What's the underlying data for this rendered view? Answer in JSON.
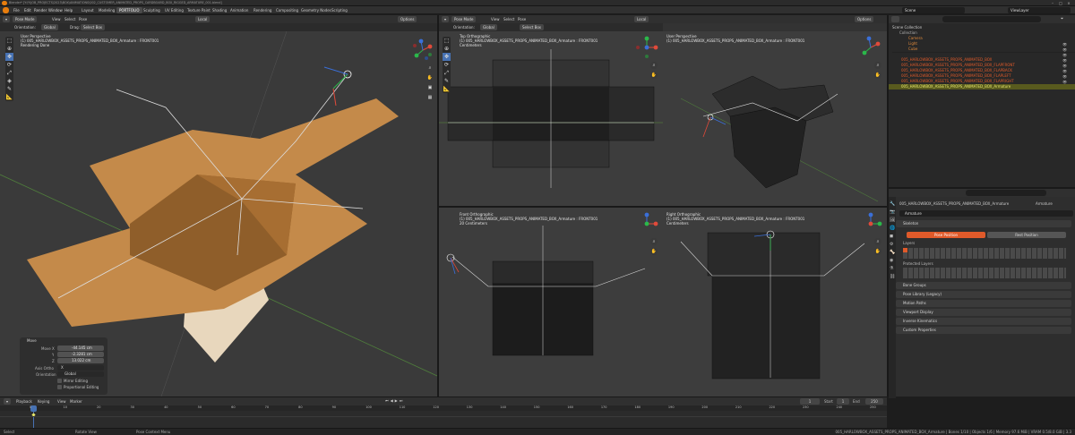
{
  "app": {
    "title": "Blender* [Y:\\Y\\JOB_PROJECTS\\2023\\BOX\\ANIMATIONS\\002_CUSTOMER_ANIMATED_PROPS_CARDBOARD_BOX_RIGGED_ARMATURE_001.blend]"
  },
  "menubar": {
    "menus": [
      "File",
      "Edit",
      "Render",
      "Window",
      "Help"
    ],
    "workspaces": [
      "Layout",
      "Modeling",
      "PORTFOLIO",
      "Sculpting",
      "UV Editing",
      "Texture Paint",
      "Shading",
      "Animation",
      "Rendering",
      "Compositing",
      "Geometry Nodes",
      "Scripting"
    ],
    "active_workspace": "PORTFOLIO",
    "scene": "Scene",
    "view_layer": "ViewLayer"
  },
  "viewport_main": {
    "mode": "Pose Mode",
    "menus": [
      "View",
      "Select",
      "Pose"
    ],
    "orientation_label": "Orientation:",
    "orientation": "Global",
    "drag_label": "Drag:",
    "drag": "Select Box",
    "transform": "Local",
    "options": "Options",
    "view_name": "User Perspective",
    "object_name": "(1) 005_HARLOWBOX_ASSETS_PROPS_ANIMATED_BOX_Armature : FRONT001",
    "stats": "Rendering Done"
  },
  "viewport_top": {
    "mode": "Pose Mode",
    "menus": [
      "View",
      "Select",
      "Pose"
    ],
    "orientation_label": "Orientation:",
    "orientation": "Global",
    "drag": "Select Box",
    "transform": "Local",
    "options": "Options",
    "view_name": "Top Orthographic",
    "object_name": "(1) 005_HARLOWBOX_ASSETS_PROPS_ANIMATED_BOX_Armature : FRONT001",
    "units": "Centimeters"
  },
  "viewport_persp": {
    "view_name": "User Perspective",
    "object_name": "(1) 005_HARLOWBOX_ASSETS_PROPS_ANIMATED_BOX_Armature : FRONT001",
    "options": "Options"
  },
  "viewport_front": {
    "view_name": "Front Orthographic",
    "object_name": "(1) 005_HARLOWBOX_ASSETS_PROPS_ANIMATED_BOX_Armature : FRONT001",
    "units": "20 Centimeters"
  },
  "viewport_right": {
    "view_name": "Right Orthographic",
    "object_name": "(1) 005_HARLOWBOX_ASSETS_PROPS_ANIMATED_BOX_Armature : FRONT001",
    "units": "Centimeters"
  },
  "move_panel": {
    "title": "Move",
    "move_x_label": "Move X",
    "move_x": "-44.145 cm",
    "move_y_label": "Y",
    "move_y": "-2.3281 cm",
    "move_z_label": "Z",
    "move_z": "13.022 cm",
    "axis_ortho_label": "Axis Ortho",
    "axis_ortho": "X",
    "orientation_label": "Orientation",
    "orientation": "Global",
    "mirror_label": "Mirror Editing",
    "proportional_label": "Proportional Editing"
  },
  "outliner": {
    "title": "Scene Collection",
    "rows": [
      "Collection",
      "Camera",
      "Light",
      "Cube",
      "005_HARLOWBOX_ASSETS_PROPS_ANIMATED_BOX",
      "005_HARLOWBOX_ASSETS_PROPS_ANIMATED_BOX_FLAPFRONT",
      "005_HARLOWBOX_ASSETS_PROPS_ANIMATED_BOX_FLAPBACK",
      "005_HARLOWBOX_ASSETS_PROPS_ANIMATED_BOX_FLAPLEFT",
      "005_HARLOWBOX_ASSETS_PROPS_ANIMATED_BOX_FLAPRIGHT",
      "005_HARLOWBOX_ASSETS_PROPS_ANIMATED_BOX_Armature"
    ]
  },
  "properties": {
    "breadcrumb": "005_HARLOWBOX_ASSETS_PROPS_ANIMATED_BOX_Armature",
    "breadcrumb2": "Armature",
    "armature_name": "Armature",
    "skeleton_label": "Skeleton",
    "pose_position": "Pose Position",
    "rest_position": "Rest Position",
    "layers_label": "Layers",
    "protected_layers_label": "Protected Layers",
    "panels": [
      "Bone Groups",
      "Pose Library (Legacy)",
      "Motion Paths",
      "Viewport Display",
      "Inverse Kinematics",
      "Custom Properties"
    ]
  },
  "timeline": {
    "menus": [
      "Playback",
      "Keying",
      "View",
      "Marker"
    ],
    "current_frame": "1",
    "start_label": "Start",
    "start": "1",
    "end_label": "End",
    "end": "250",
    "ticks": [
      "0",
      "10",
      "20",
      "30",
      "40",
      "50",
      "60",
      "70",
      "80",
      "90",
      "100",
      "110",
      "120",
      "130",
      "140",
      "150",
      "160",
      "170",
      "180",
      "190",
      "200",
      "210",
      "220",
      "230",
      "240",
      "250"
    ]
  },
  "statusbar": {
    "left1": "Select",
    "left2": "Rotate View",
    "left3": "Pose Context Menu",
    "right": "005_HARLOWBOX_ASSETS_PROPS_ANIMATED_BOX_Armature | Bones 1/10 | Objects 1/6 | Memory 97.6 MiB | VRAM 0.5/8.0 GiB | 3.3"
  }
}
